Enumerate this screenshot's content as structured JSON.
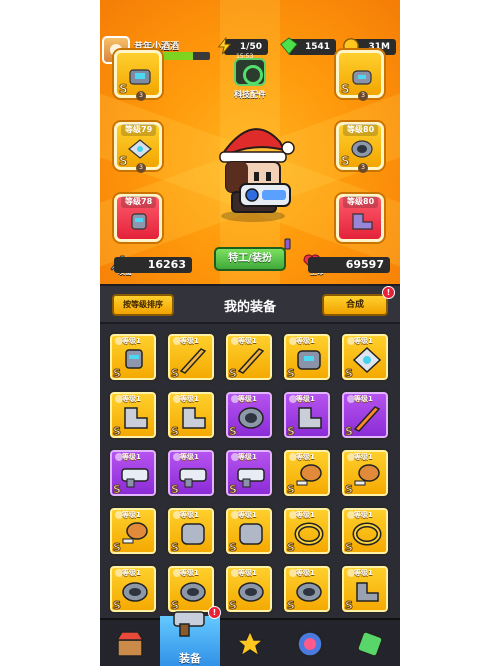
{
  "player": {
    "name": "昔年小酒酒",
    "level": "79",
    "xp_fraction": 0.78
  },
  "resources": {
    "energy": "1/50",
    "energy_timer": "15:53",
    "gems": "1541",
    "coins": "31M"
  },
  "tech_parts": {
    "label": "科技配件"
  },
  "equipped": {
    "slot_left_mid": {
      "level": "等级79",
      "stars": "3"
    },
    "slot_right_mid": {
      "level": "等级80",
      "stars": "3"
    },
    "slot_left_low": {
      "level": "等级78"
    },
    "slot_right_low": {
      "level": "等级80"
    },
    "slot_left_top": {
      "stars": "3"
    },
    "slot_right_top": {
      "stars": "3"
    }
  },
  "stats": {
    "attack_label": "攻击",
    "attack_value": "16263",
    "hp_label": "生命",
    "hp_value": "69597"
  },
  "spec_button": "特工/装扮",
  "title_bar": {
    "sort_button": "按等级排序",
    "title": "我的装备",
    "merge_button": "合成",
    "merge_badge": "!"
  },
  "grid_level_label": "等级1",
  "grid_s_label": "S",
  "grid_badge_counts": {
    "r1c3": "2",
    "r2c2": "3",
    "r2c3": "2",
    "r2c4": "2"
  },
  "nav": {
    "active_label": "装备",
    "active_badge": "!"
  },
  "colors": {
    "hero_bg": "#ff9a0c",
    "gold_cell": "#ffd12e",
    "purple_cell": "#8a2ad6",
    "nav_active": "#2f8fe6"
  }
}
